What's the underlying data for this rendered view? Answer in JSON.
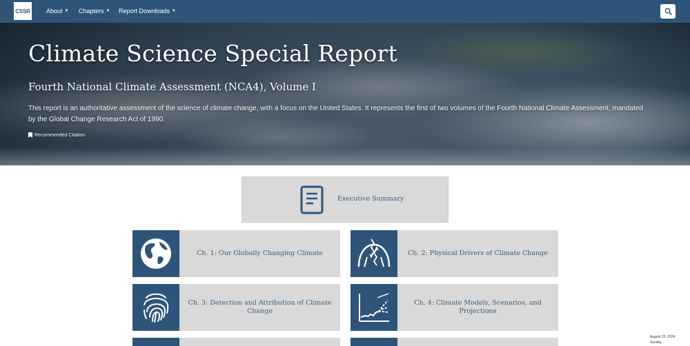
{
  "nav": {
    "logo_text": "CSSR",
    "items": [
      {
        "label": "About"
      },
      {
        "label": "Chapters"
      },
      {
        "label": "Report Downloads"
      }
    ],
    "search_icon": "search-icon"
  },
  "hero": {
    "title": "Climate Science Special Report",
    "subtitle": "Fourth National Climate Assessment (NCA4), Volume I",
    "description": "This report is an authoritative assessment of the science of climate change, with a focus on the United States. It represents the first of two volumes of the Fourth National Climate Assessment, mandated by the Global Change Research Act of 1990.",
    "citation_label": "Recommended Citation"
  },
  "executive_summary": {
    "label": "Executive Summary",
    "icon": "document-icon"
  },
  "chapters": [
    {
      "label": "Ch. 1: Our Globally Changing Climate",
      "icon": "globe-icon"
    },
    {
      "label": "Ch. 2: Physical Drivers of Climate Change",
      "icon": "radiation-arc-icon"
    },
    {
      "label": "Ch. 3: Detection and Attribution of Climate Change",
      "icon": "fingerprint-icon"
    },
    {
      "label": "Ch. 4: Climate Models, Scenarios, and Projections",
      "icon": "chart-projection-icon"
    }
  ],
  "date_overlay": {
    "date": "August 25, 2024",
    "day": "Sunday"
  },
  "colors": {
    "brand_blue": "#2e5579",
    "card_gray": "#d9d9d9",
    "card_text": "#3e5f7d"
  }
}
